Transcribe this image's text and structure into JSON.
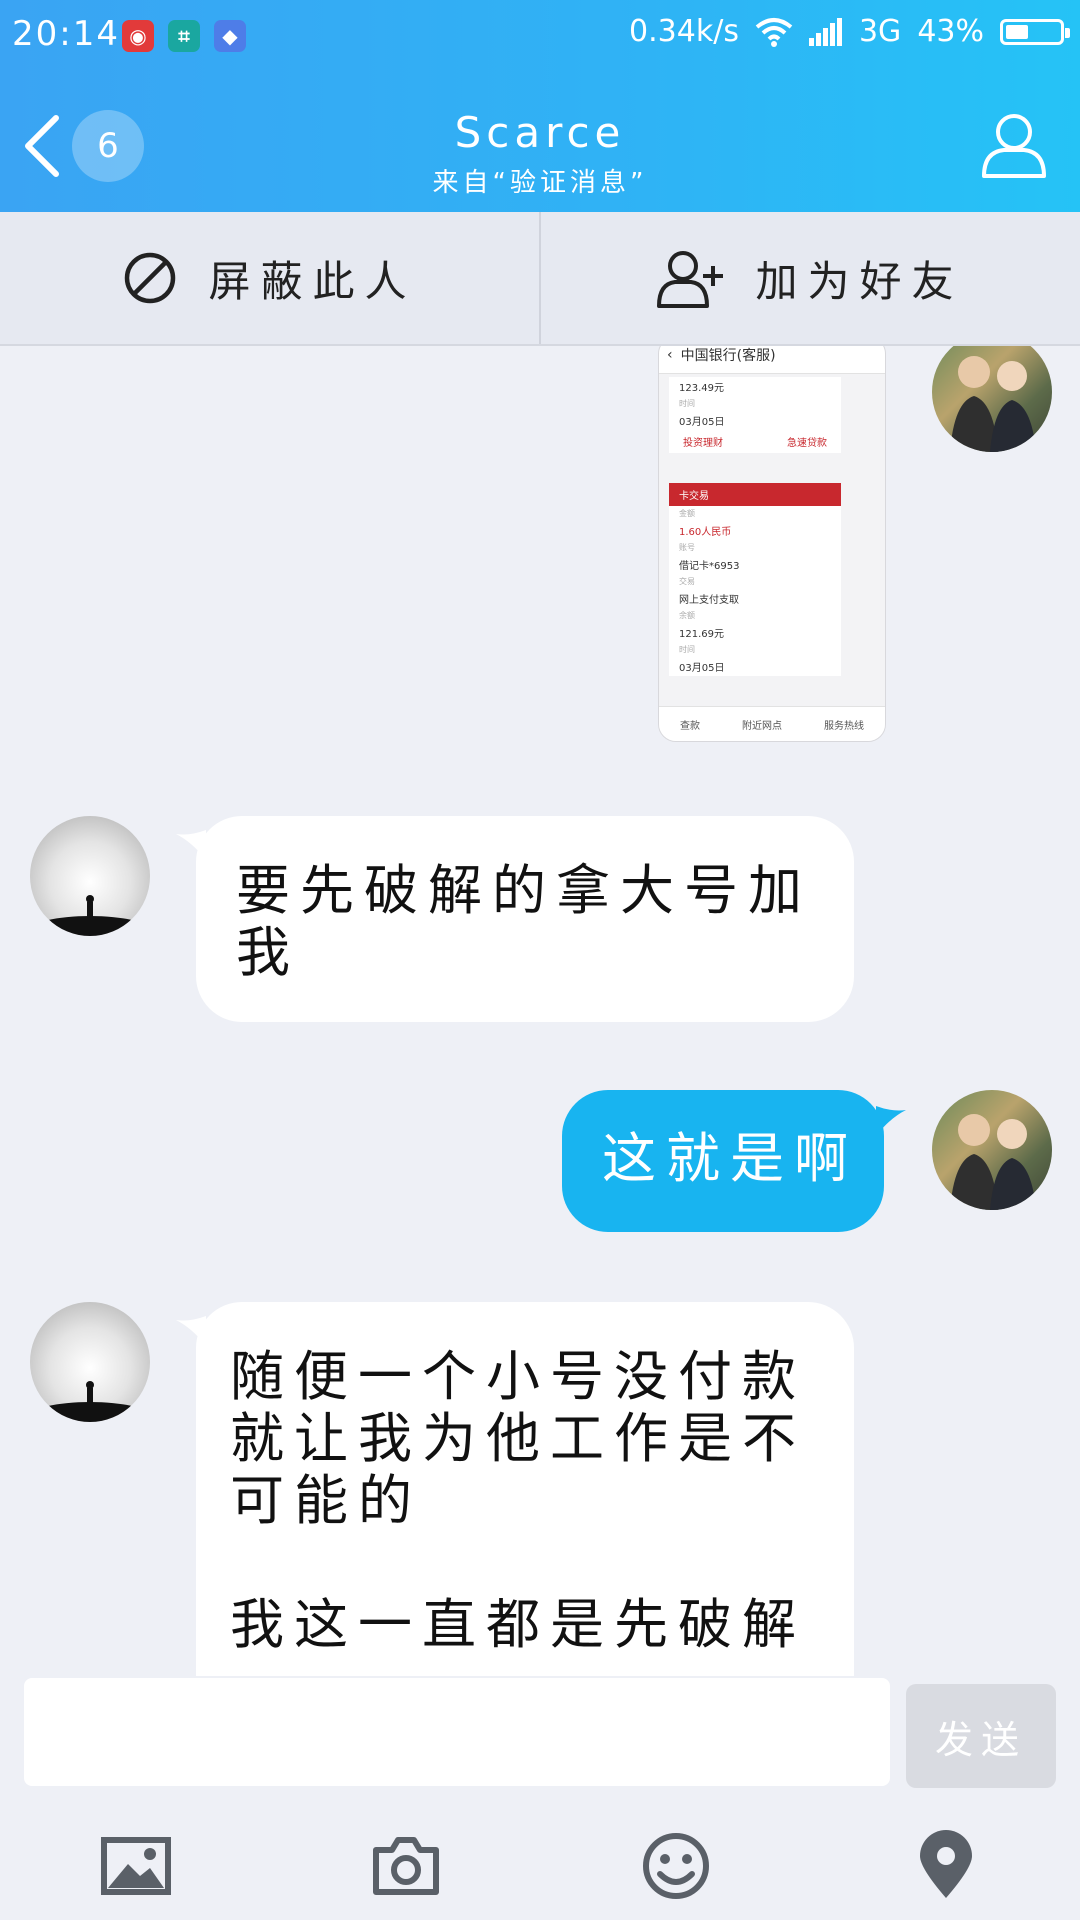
{
  "status_bar": {
    "time": "20:14",
    "speed": "0.34k/s",
    "network": "3G",
    "battery_text": "43%",
    "battery_level": 0.43
  },
  "header": {
    "unread_count": "6",
    "title": "Scarce",
    "subtitle": "来自“验证消息”"
  },
  "actions": {
    "block_label": "屏蔽此人",
    "add_friend_label": "加为好友"
  },
  "shared_image": {
    "header": "中国银行(客服)",
    "record1": {
      "amount": "123.49元",
      "time_label": "时间",
      "date": "03月05日"
    },
    "links": [
      "投资理财",
      "急速贷款"
    ],
    "section_title": "卡交易",
    "record2": {
      "amount_label": "金额",
      "amount_value": "1.60人民币",
      "account_label": "账号",
      "account_value": "借记卡*6953",
      "type_label": "交易",
      "type_value": "网上支付支取",
      "balance_label": "余额",
      "balance_value": "121.69元",
      "time_label": "时间",
      "date": "03月05日"
    },
    "bottom_tabs": [
      "查款",
      "附近网点",
      "服务热线"
    ]
  },
  "messages": [
    {
      "side": "in",
      "text": "要先破解的拿大号加我"
    },
    {
      "side": "out",
      "text": "这就是啊"
    },
    {
      "side": "in",
      "text": "随便一个小号没付款就让我为他工作是不可能的\n\n我这一直都是先破解"
    }
  ],
  "composer": {
    "placeholder": "",
    "send_label": "发送"
  },
  "colors": {
    "header_gradient_start": "#3aa4f3",
    "header_gradient_end": "#25c3f6",
    "outgoing_bubble": "#18b4f0",
    "incoming_bubble": "#ffffff"
  }
}
